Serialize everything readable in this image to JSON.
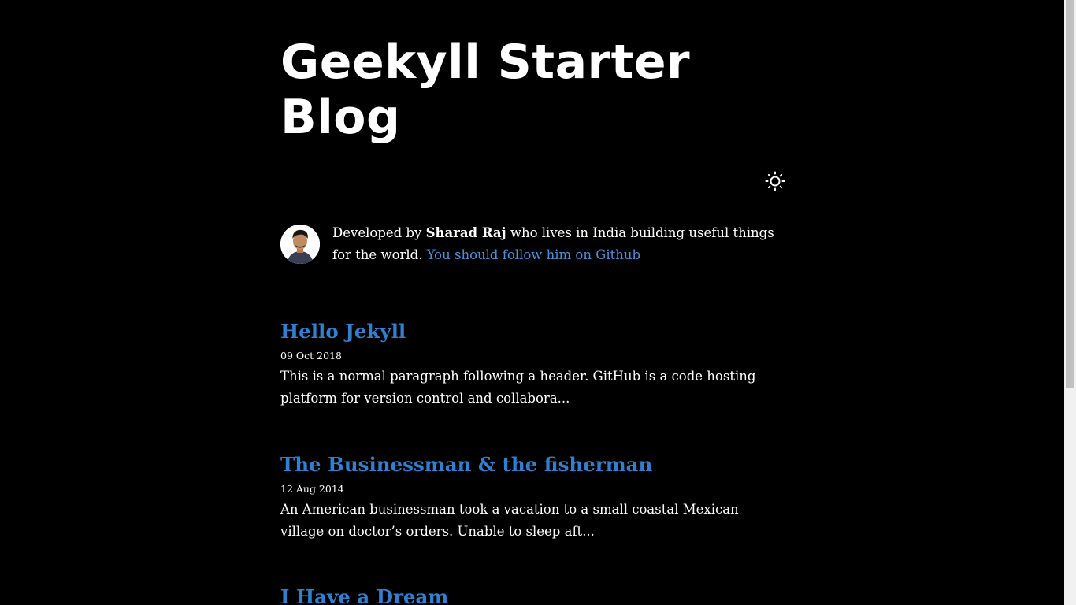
{
  "site": {
    "title": "Geekyll Starter Blog",
    "theme_toggle_icon": "sun-icon"
  },
  "bio": {
    "prefix": "Developed by ",
    "author": "Sharad Raj",
    "middle": " who lives in India building useful things for the world. ",
    "link_text": "You should follow him on Github",
    "avatar_icon": "avatar-photo",
    "link_color": "#4a90d9"
  },
  "posts": [
    {
      "title": "Hello Jekyll",
      "date": "09 Oct 2018",
      "excerpt": "This is a normal paragraph following a header. GitHub is a code hosting platform for version control and collabora..."
    },
    {
      "title": "The Businessman & the fisherman",
      "date": "12 Aug 2014",
      "excerpt": "An American businessman took a vacation to a small coastal Mexican village on doctor’s orders. Unable to sleep aft..."
    },
    {
      "title": "I Have a Dream",
      "date": "",
      "excerpt": ""
    }
  ],
  "colors": {
    "background": "#000000",
    "text": "#ffffff",
    "post_title": "#2f80d1"
  }
}
